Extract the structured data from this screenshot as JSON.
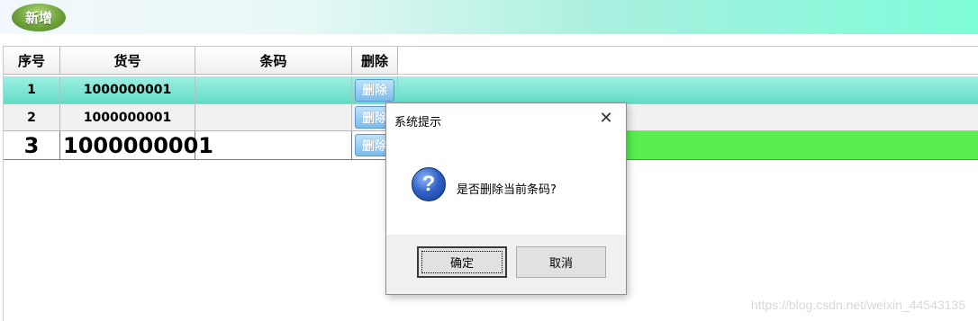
{
  "toolbar": {
    "new_label": "新增"
  },
  "grid": {
    "headers": {
      "seq": "序号",
      "item_no": "货号",
      "barcode": "条码",
      "delete": "删除"
    },
    "rows": [
      {
        "seq": "1",
        "item_no": "1000000001",
        "barcode": "",
        "delete_label": "删除"
      },
      {
        "seq": "2",
        "item_no": "1000000001",
        "barcode": "",
        "delete_label": "删除"
      },
      {
        "seq": "3",
        "item_no": "1000000001",
        "barcode": "",
        "delete_label": "删除"
      }
    ]
  },
  "dialog": {
    "title": "系统提示",
    "close_glyph": "✕",
    "icon": "question-icon",
    "icon_glyph": "?",
    "message": "是否删除当前条码?",
    "ok_label": "确定",
    "cancel_label": "取消"
  },
  "watermark": "https://blog.csdn.net/weixin_44543135",
  "colors": {
    "toolbar_gradient_end": "#7dfcd8",
    "selected_row": "#5fdcc5",
    "edited_row_highlight": "#59ee4d",
    "delete_button": "#7cbcea"
  }
}
